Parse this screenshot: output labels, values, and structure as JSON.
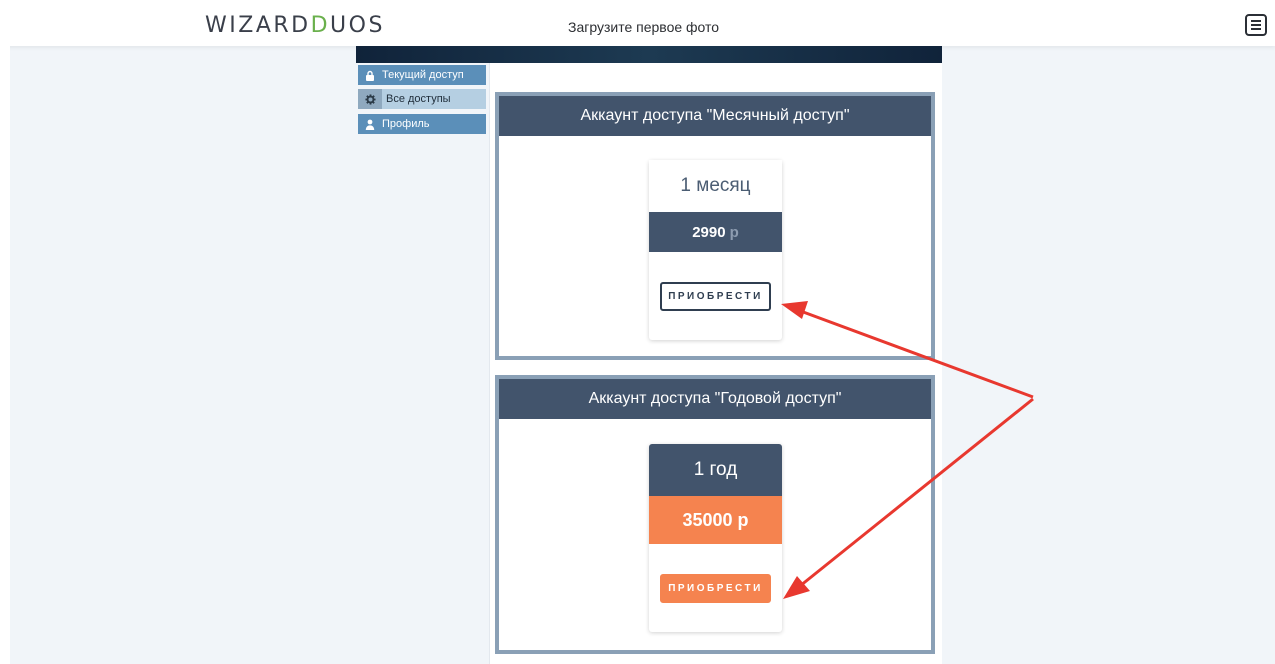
{
  "header": {
    "logo_part1": "WIZARD",
    "logo_part2": "D",
    "logo_part3": "UOS",
    "upload_link": "Загрузите первое фото",
    "menu_icon": "hamburger-icon"
  },
  "sidebar": {
    "items": [
      {
        "label": "Текущий доступ",
        "icon": "lock-icon"
      },
      {
        "label": "Все доступы",
        "icon": "gear-icon"
      },
      {
        "label": "Профиль",
        "icon": "user-icon"
      }
    ]
  },
  "plans": [
    {
      "header": "Аккаунт доступа \"Месячный доступ\"",
      "duration": "1 месяц",
      "price": "2990",
      "currency": "р",
      "button": "ПРИОБРЕСТИ"
    },
    {
      "header": "Аккаунт доступа \"Годовой доступ\"",
      "duration": "1 год",
      "price": "35000",
      "currency": "р",
      "button": "ПРИОБРЕСТИ"
    }
  ],
  "colors": {
    "accent_green": "#6ab04c",
    "plan_header": "#42546c",
    "orange": "#f5834f",
    "annotation_red": "#e8382f"
  }
}
